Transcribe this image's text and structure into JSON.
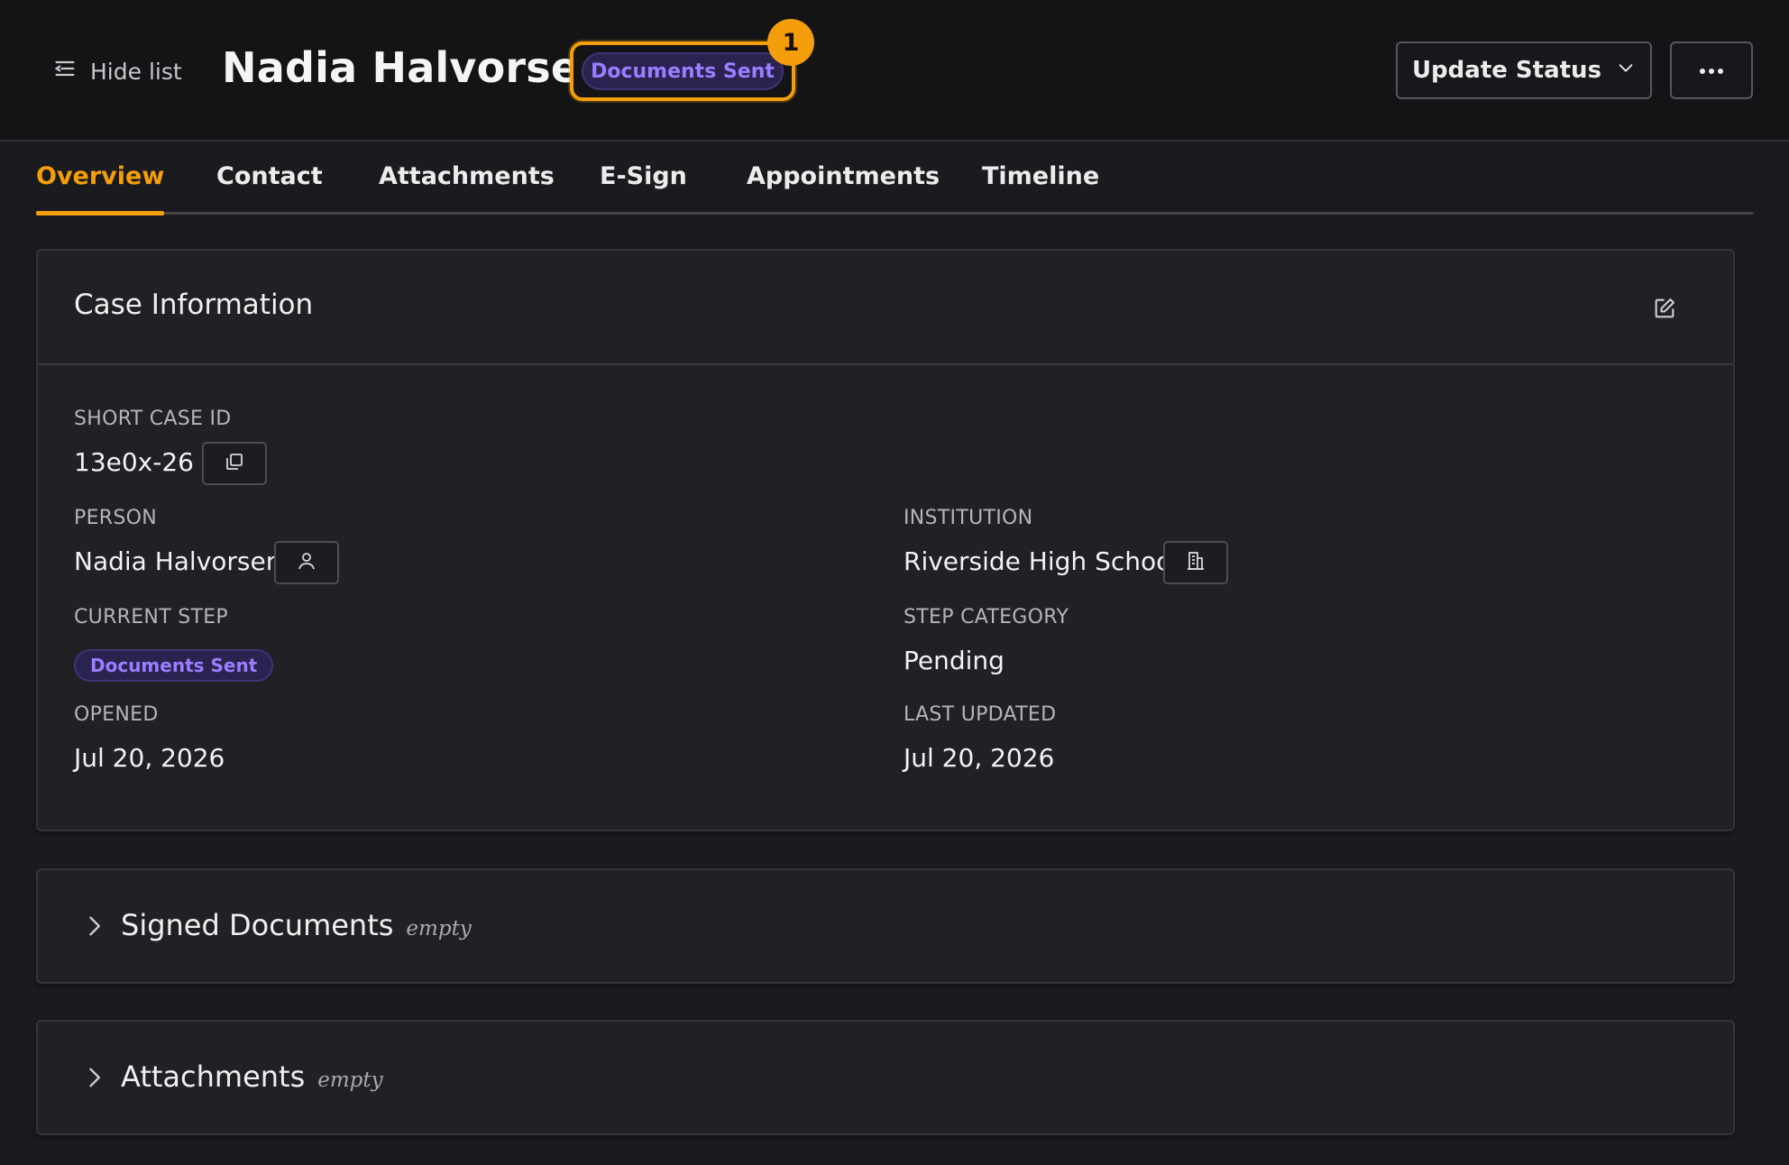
{
  "header": {
    "hide_list_label": "Hide list",
    "title": "Nadia Halvorsen",
    "status_pill": "Documents Sent",
    "notification_count": "1",
    "update_status_label": "Update Status"
  },
  "tabs": [
    {
      "label": "Overview",
      "active": true
    },
    {
      "label": "Contact",
      "active": false
    },
    {
      "label": "Attachments",
      "active": false
    },
    {
      "label": "E-Sign",
      "active": false
    },
    {
      "label": "Appointments",
      "active": false
    },
    {
      "label": "Timeline",
      "active": false
    }
  ],
  "case_info": {
    "title": "Case Information",
    "short_case_id_label": "SHORT CASE ID",
    "short_case_id": "13e0x-26",
    "person_label": "PERSON",
    "person": "Nadia Halvorsen",
    "institution_label": "INSTITUTION",
    "institution": "Riverside High School",
    "current_step_label": "CURRENT STEP",
    "current_step": "Documents Sent",
    "step_category_label": "STEP CATEGORY",
    "step_category": "Pending",
    "opened_label": "OPENED",
    "opened": "Jul 20, 2026",
    "last_updated_label": "LAST UPDATED",
    "last_updated": "Jul 20, 2026"
  },
  "sections": {
    "signed_documents": {
      "title": "Signed Documents",
      "state": "empty"
    },
    "attachments": {
      "title": "Attachments",
      "state": "empty"
    }
  },
  "colors": {
    "accent": "#f59e0b",
    "status_purple": "#9b7dff",
    "background": "#1a1b1e"
  },
  "icons": [
    "list-icon",
    "chevron-down-icon",
    "ellipsis-icon",
    "edit-icon",
    "copy-icon",
    "user-icon",
    "building-icon",
    "chevron-right-icon"
  ]
}
